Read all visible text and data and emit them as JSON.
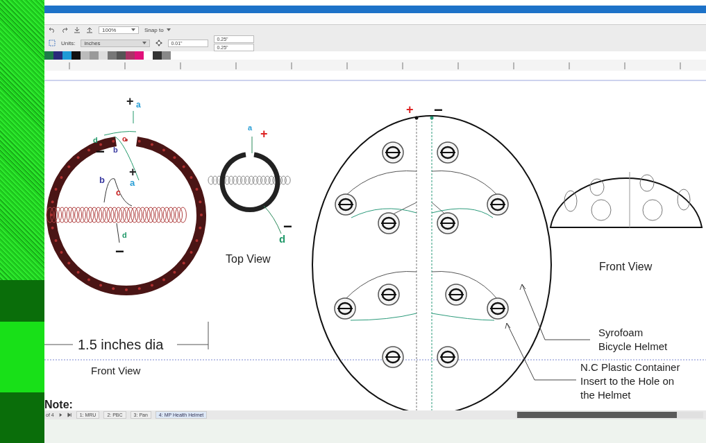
{
  "toolbar": {
    "zoom": "100%",
    "snap": "Snap to"
  },
  "property_bar": {
    "units_label": "Units:",
    "units": "inches",
    "nudge": "0.01\"",
    "dup_x": "0.25\"",
    "dup_y": "0.25\""
  },
  "canvas": {
    "labels": [
      {
        "text": "+",
        "color": "#222222"
      },
      {
        "text": "a",
        "color": "#2a9fd6"
      },
      {
        "text": "c",
        "color": "#cc2222"
      },
      {
        "text": "d",
        "color": "#22996a"
      },
      {
        "text": "b",
        "color": "#3a3aa0"
      },
      {
        "text": "−",
        "color": "#111111"
      },
      {
        "text": "+",
        "color": "#222222"
      },
      {
        "text": "a",
        "color": "#2a9fd6"
      },
      {
        "text": "b",
        "color": "#3a3aa0"
      },
      {
        "text": "c",
        "color": "#cc2222"
      },
      {
        "text": "d",
        "color": "#22996a"
      },
      {
        "text": "−",
        "color": "#111111"
      },
      {
        "text": "a",
        "color": "#2a9fd6"
      },
      {
        "text": "+",
        "color": "#dd2222"
      },
      {
        "text": "−",
        "color": "#111111"
      },
      {
        "text": "d",
        "color": "#22996a"
      },
      {
        "text": "+",
        "color": "#dd2222"
      },
      {
        "text": "−",
        "color": "#111111"
      }
    ],
    "captions": [
      "Top View",
      "1.5 inches dia",
      "Front View",
      "Front View",
      "Note:"
    ],
    "notes": [
      {
        "lines": [
          "Syrofoam",
          "Bicycle Helmet"
        ]
      },
      {
        "lines": [
          "N.C Plastic Container",
          "Insert to the Hole on",
          "the Helmet"
        ]
      }
    ]
  },
  "page_nav": {
    "count": "of 4",
    "tabs": [
      {
        "label": "1: MRU",
        "selected": false
      },
      {
        "label": "2: PBC",
        "selected": false
      },
      {
        "label": "3: Pan",
        "selected": false
      },
      {
        "label": "4: MP Health Helmet",
        "selected": true
      }
    ]
  }
}
